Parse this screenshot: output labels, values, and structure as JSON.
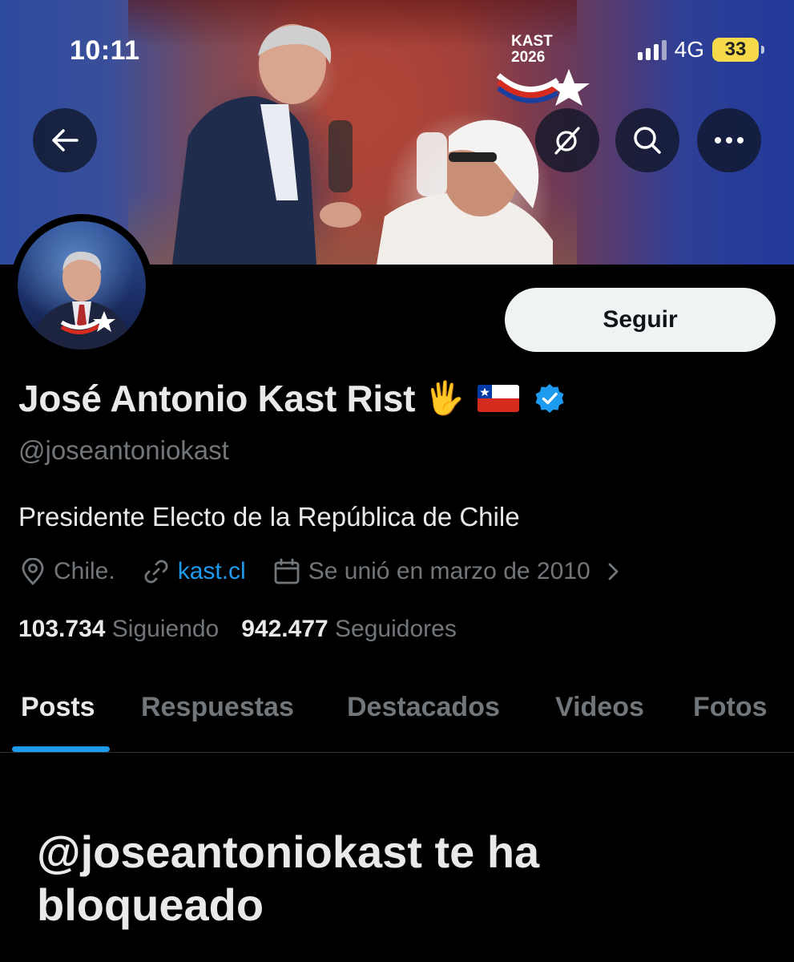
{
  "status_bar": {
    "time": "10:11",
    "network": "4G",
    "battery": "33"
  },
  "banner": {
    "logo_line1": "KAST",
    "logo_line2": "2026",
    "colors": {
      "blue": "#2c4a9e",
      "red": "#a8463c"
    }
  },
  "nav": {
    "back_icon": "arrow-left-icon",
    "grok_icon": "grok-icon",
    "search_icon": "search-icon",
    "more_icon": "more-icon"
  },
  "profile": {
    "follow_label": "Seguir",
    "display_name": "José Antonio Kast Rist",
    "name_emoji": "🖐",
    "handle": "@joseantoniokast",
    "bio": "Presidente Electo de la República de Chile",
    "location": "Chile.",
    "website": "kast.cl",
    "joined": "Se unió en marzo de 2010",
    "following_count": "103.734",
    "following_label": "Siguiendo",
    "followers_count": "942.477",
    "followers_label": "Seguidores",
    "verified_color": "#1d9bf0"
  },
  "tabs": [
    {
      "label": "Posts",
      "active": true
    },
    {
      "label": "Respuestas",
      "active": false
    },
    {
      "label": "Destacados",
      "active": false
    },
    {
      "label": "Videos",
      "active": false
    },
    {
      "label": "Fotos",
      "active": false
    }
  ],
  "blocked_message": "@joseantoniokast te ha bloqueado"
}
